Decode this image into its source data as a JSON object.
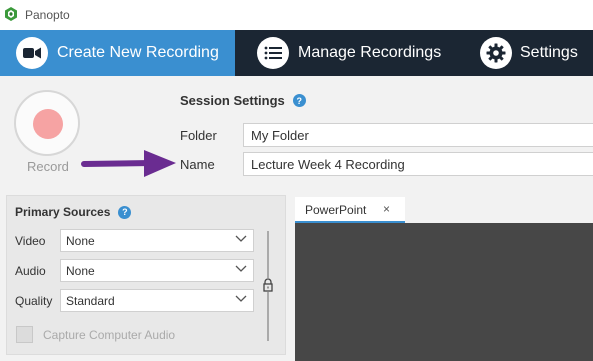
{
  "app": {
    "title": "Panopto"
  },
  "nav": {
    "tabs": [
      {
        "label": "Create New Recording",
        "icon": "video-camera-icon",
        "active": true
      },
      {
        "label": "Manage Recordings",
        "icon": "list-icon",
        "active": false
      },
      {
        "label": "Settings",
        "icon": "gear-icon",
        "active": false
      }
    ]
  },
  "record": {
    "label": "Record"
  },
  "session": {
    "heading": "Session Settings",
    "folder_label": "Folder",
    "folder_value": "My Folder",
    "name_label": "Name",
    "name_value": "Lecture Week 4 Recording"
  },
  "sources": {
    "heading": "Primary Sources",
    "video_label": "Video",
    "video_value": "None",
    "audio_label": "Audio",
    "audio_value": "None",
    "quality_label": "Quality",
    "quality_value": "Standard",
    "capture_audio_label": "Capture Computer Audio",
    "capture_audio_checked": false
  },
  "preview": {
    "tab_label": "PowerPoint",
    "close_glyph": "×"
  },
  "colors": {
    "accent": "#3a8fd0",
    "nav_bg": "#1b2633",
    "arrow": "#6a2c91",
    "record_dot": "#f6a3a3",
    "preview_bg": "#474747"
  }
}
